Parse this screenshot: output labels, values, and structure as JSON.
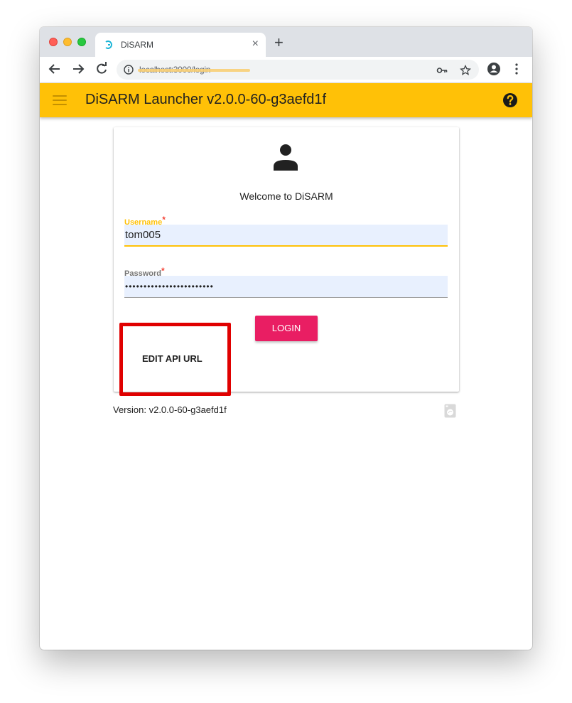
{
  "browser": {
    "tab_title": "DiSARM",
    "tab_close": "×",
    "new_tab": "+",
    "url": "localhost:3000/login"
  },
  "app": {
    "title": "DiSARM Launcher v2.0.0-60-g3aefd1f"
  },
  "login": {
    "welcome": "Welcome to DiSARM",
    "username_label": "Username",
    "username_value": "tom005",
    "password_label": "Password",
    "password_value": "••••••••••••••••••••••••",
    "required_mark": "*",
    "login_button": "LOGIN",
    "edit_api_button": "EDIT API URL"
  },
  "footer": {
    "version": "Version: v2.0.0-60-g3aefd1f"
  },
  "colors": {
    "appbar": "#ffc107",
    "login_button": "#e91e63",
    "highlight": "#e00000"
  }
}
